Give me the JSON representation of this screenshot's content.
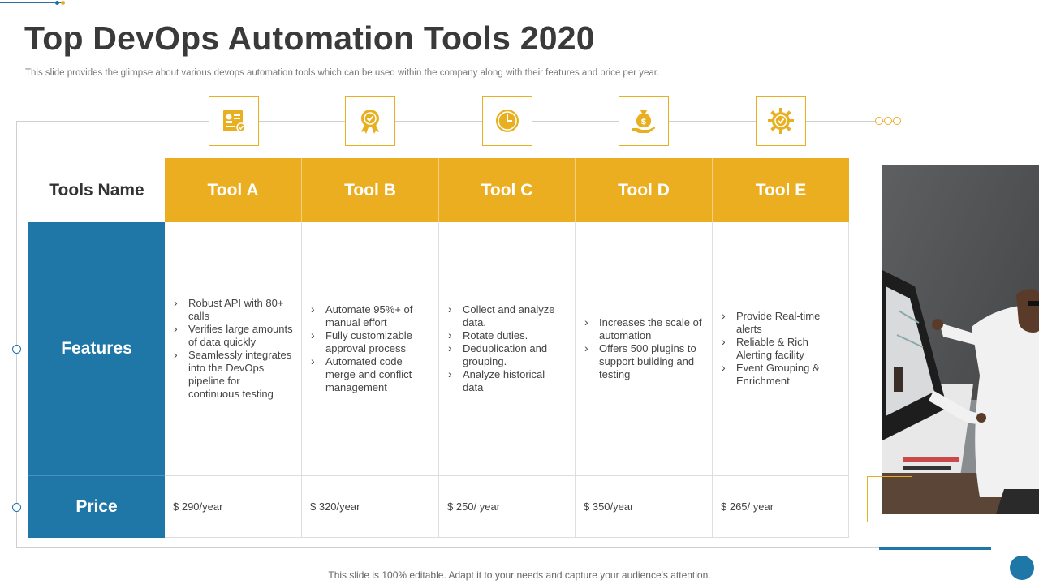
{
  "title": "Top DevOps Automation Tools 2020",
  "subtitle": "This slide provides the glimpse about various devops automation tools which can be used within the company along with their features and price per year.",
  "table": {
    "corner_label": "Tools Name",
    "row_labels": {
      "features": "Features",
      "price": "Price"
    },
    "tools": [
      {
        "name": "Tool A",
        "icon": "certificate-icon",
        "features": [
          "Robust API with 80+ calls",
          "Verifies large amounts of data quickly",
          "Seamlessly integrates into the DevOps pipeline for continuous testing"
        ],
        "price": "$ 290/year"
      },
      {
        "name": "Tool B",
        "icon": "award-badge-icon",
        "features": [
          "Automate 95%+ of manual effort",
          "Fully customizable approval process",
          "Automated code merge and conflict management"
        ],
        "price": "$ 320/year"
      },
      {
        "name": "Tool C",
        "icon": "clock-icon",
        "features": [
          "Collect and analyze data.",
          "Rotate duties.",
          "Deduplication and grouping.",
          "Analyze historical data"
        ],
        "price": "$ 250/ year"
      },
      {
        "name": "Tool D",
        "icon": "money-bag-hand-icon",
        "features": [
          "Increases the scale of automation",
          "Offers 500 plugins to support building and testing"
        ],
        "price": "$ 350/year"
      },
      {
        "name": "Tool E",
        "icon": "gear-check-icon",
        "features": [
          "Provide Real-time alerts",
          "Reliable & Rich Alerting facility",
          "Event Grouping & Enrichment"
        ],
        "price": "$ 265/ year"
      }
    ]
  },
  "footer": "This slide is 100% editable. Adapt it to your needs and capture your audience's attention.",
  "colors": {
    "accent": "#ecae21",
    "primary": "#1f77a8"
  }
}
